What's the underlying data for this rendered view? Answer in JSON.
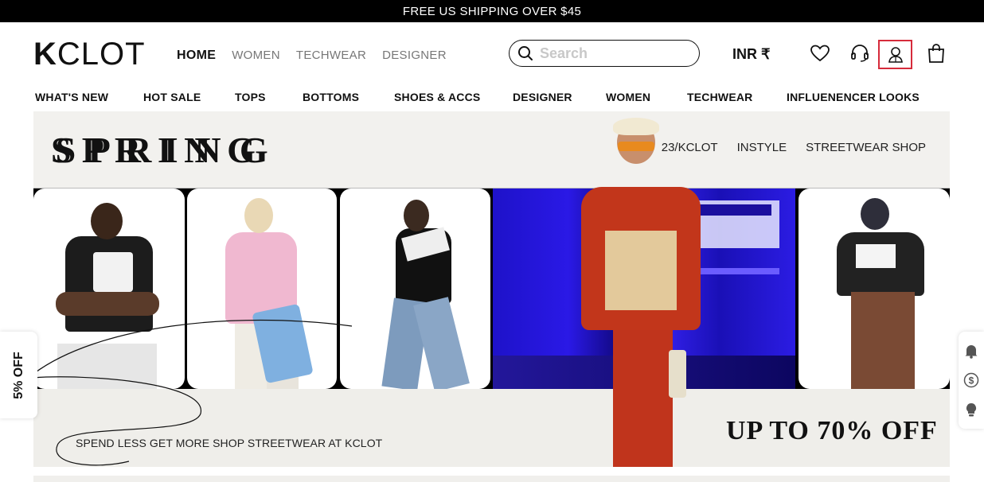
{
  "announcement": "FREE US SHIPPING OVER $45",
  "logo": {
    "k": "K",
    "rest": "CLOT"
  },
  "main_nav": [
    {
      "label": "HOME",
      "active": true
    },
    {
      "label": "WOMEN",
      "active": false
    },
    {
      "label": "TECHWEAR",
      "active": false
    },
    {
      "label": "DESIGNER",
      "active": false
    }
  ],
  "search": {
    "placeholder": "Search",
    "value": ""
  },
  "currency": "INR ₹",
  "header_icons": [
    "heart-icon",
    "headset-icon",
    "account-icon",
    "shopping-bag-icon"
  ],
  "categories": [
    "WHAT'S NEW",
    "HOT SALE",
    "TOPS",
    "BOTTOMS",
    "SHOES & ACCS",
    "DESIGNER",
    "WOMEN",
    "TECHWEAR",
    "INFLUENENCER LOOKS"
  ],
  "banner": {
    "title_letters": [
      "S",
      "S",
      "P",
      "P",
      "R",
      "R",
      "I",
      "I",
      "N",
      "N",
      "G",
      "G"
    ],
    "links": [
      "23/KCLOT",
      "INSTYLE",
      "STREETWEAR SHOP"
    ],
    "tagline": "SPEND LESS GET MORE SHOP STREETWEAR AT KCLOT",
    "offer": "UP TO 70% OFF"
  },
  "side_tab": "5% OFF",
  "side_tools": [
    "bell-icon",
    "dollar-icon",
    "bulb-icon"
  ],
  "colors": {
    "accent_border": "#d62b3b",
    "banner_bg": "#f2f1ee",
    "blue_panel": "#2a19e6"
  }
}
